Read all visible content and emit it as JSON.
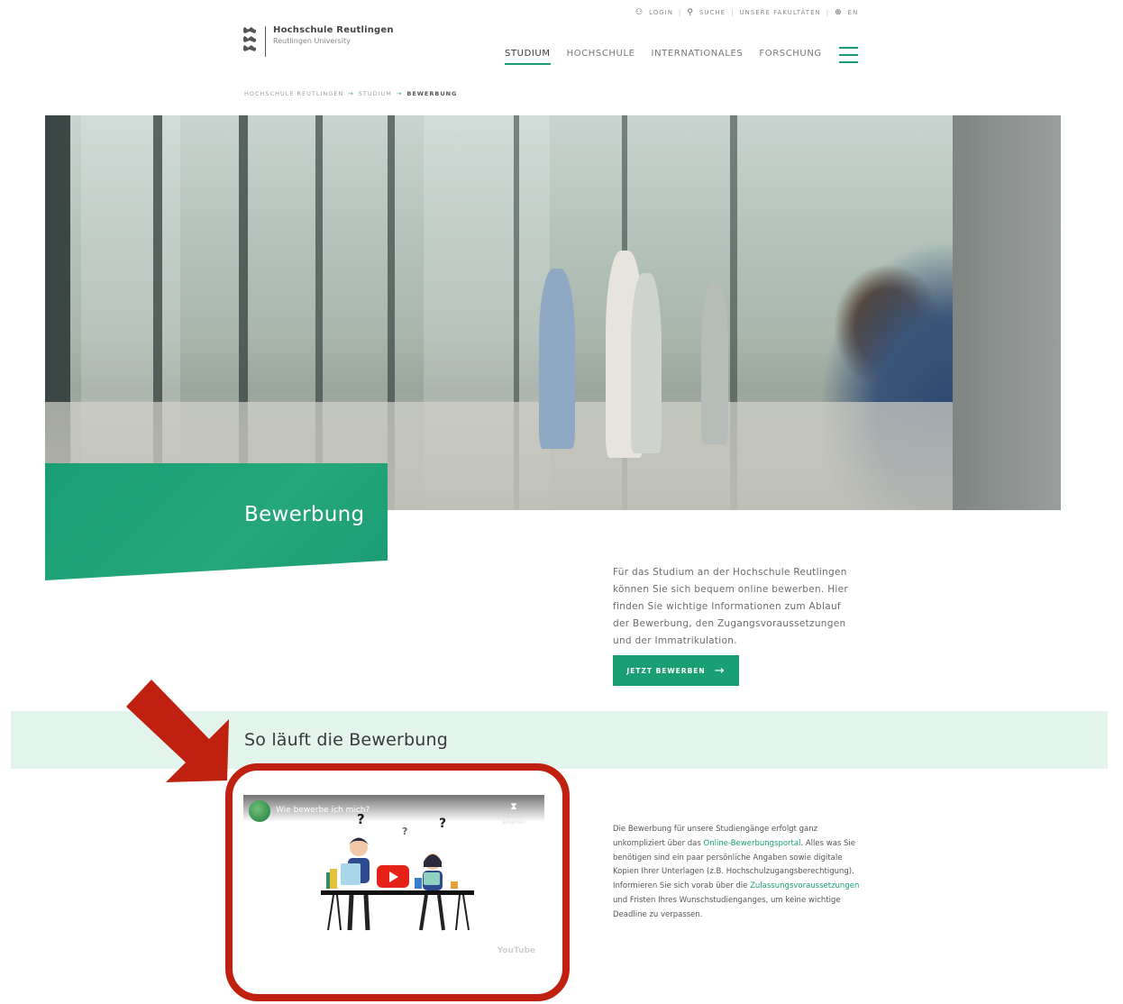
{
  "utility": {
    "login": "LOGIN",
    "search": "SUCHE",
    "company": "UNSERE FAKULTÄTEN",
    "language": "EN"
  },
  "logo": {
    "name": "Hochschule Reutlingen",
    "subtitle": "Reutlingen University"
  },
  "nav": {
    "items": [
      "STUDIUM",
      "HOCHSCHULE",
      "INTERNATIONALES",
      "FORSCHUNG"
    ],
    "active_index": 0
  },
  "breadcrumb": [
    "HOCHSCHULE REUTLINGEN",
    "STUDIUM",
    "BEWERBUNG"
  ],
  "hero": {
    "title": "Bewerbung"
  },
  "intro": {
    "text": "Für das Studium an der Hochschule Reutlingen können Sie sich bequem online bewerben. Hier finden Sie wichtige Informationen zum Ablauf der Bewerbung, den Zugangsvoraussetzungen und der Immatrikulation.",
    "cta_label": "JETZT BEWERBEN"
  },
  "section": {
    "heading": "So läuft die Bewerbung"
  },
  "video": {
    "title": "Wie bewerbe ich mich?",
    "watch_later": "Später ansehen",
    "platform": "YouTube"
  },
  "body": {
    "part1": "Die Bewerbung für unsere Studiengänge erfolgt ganz unkompliziert über das ",
    "link1": "Online-Bewerbungsportal",
    "part2": ". Alles was Sie benötigen sind ein paar persönliche Angaben sowie digitale Kopien Ihrer Unterlagen (z.B. Hochschulzugangsberechtigung). Informieren Sie sich vorab über die ",
    "link2": "Zulassungsvoraussetzungen",
    "part3": " und Fristen Ihres Wunschstudienganges, um keine wichtige Deadline zu verpassen."
  },
  "colors": {
    "brand_green": "#1a9e74",
    "section_bg": "#e3f4ec",
    "highlight_red": "#c0200f"
  }
}
